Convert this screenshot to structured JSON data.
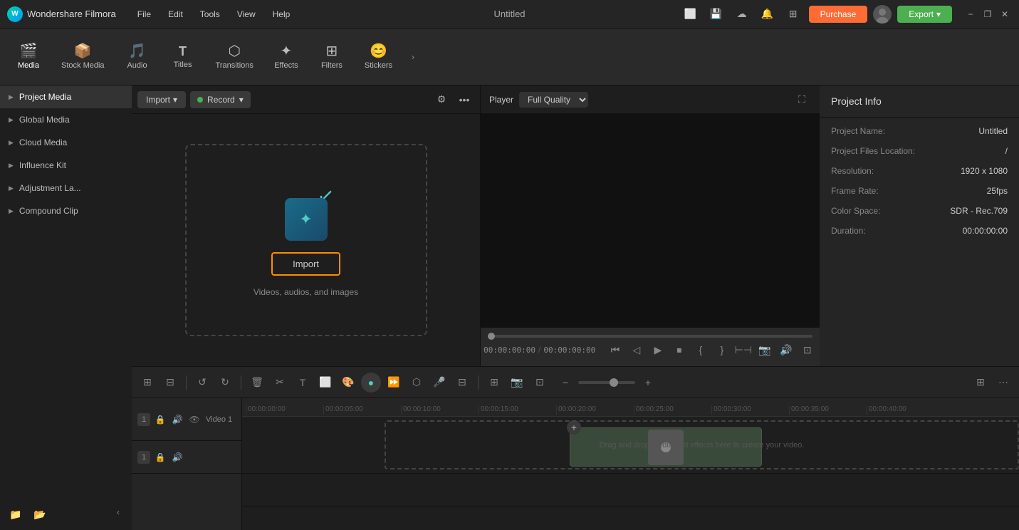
{
  "app": {
    "name": "Wondershare Filmora",
    "title": "Untitled"
  },
  "titlebar": {
    "menus": [
      "File",
      "Edit",
      "Tools",
      "View",
      "Help"
    ],
    "purchase_label": "Purchase",
    "export_label": "Export",
    "win_minimize": "−",
    "win_restore": "❐",
    "win_close": "✕"
  },
  "toolbar": {
    "items": [
      {
        "id": "media",
        "icon": "🎬",
        "label": "Media"
      },
      {
        "id": "stock",
        "icon": "📦",
        "label": "Stock Media"
      },
      {
        "id": "audio",
        "icon": "🎵",
        "label": "Audio"
      },
      {
        "id": "titles",
        "icon": "T",
        "label": "Titles"
      },
      {
        "id": "transitions",
        "icon": "⬡",
        "label": "Transitions"
      },
      {
        "id": "effects",
        "icon": "✦",
        "label": "Effects"
      },
      {
        "id": "filters",
        "icon": "⊞",
        "label": "Filters"
      },
      {
        "id": "stickers",
        "icon": "😊",
        "label": "Stickers"
      }
    ],
    "more_label": "›"
  },
  "sidebar": {
    "items": [
      {
        "id": "project-media",
        "label": "Project Media",
        "active": true
      },
      {
        "id": "global-media",
        "label": "Global Media"
      },
      {
        "id": "cloud-media",
        "label": "Cloud Media"
      },
      {
        "id": "influence-kit",
        "label": "Influence Kit"
      },
      {
        "id": "adjustment-layer",
        "label": "Adjustment La..."
      },
      {
        "id": "compound-clip",
        "label": "Compound Clip"
      }
    ]
  },
  "media_panel": {
    "import_label": "Import",
    "record_label": "Record",
    "drop_hint": "Videos, audios, and images",
    "import_center_label": "Import"
  },
  "preview": {
    "title": "Player",
    "quality": "Full Quality",
    "time_current": "00:00:00:00",
    "time_total": "00:00:00:00",
    "time_sep": "/"
  },
  "project_info": {
    "title": "Project Info",
    "fields": [
      {
        "label": "Project Name:",
        "value": "Untitled"
      },
      {
        "label": "Project Files Location:",
        "value": "/"
      },
      {
        "label": "Resolution:",
        "value": "1920 x 1080"
      },
      {
        "label": "Frame Rate:",
        "value": "25fps"
      },
      {
        "label": "Color Space:",
        "value": "SDR - Rec.709"
      },
      {
        "label": "Duration:",
        "value": "00:00:00:00"
      }
    ]
  },
  "timeline": {
    "ruler_marks": [
      "00:00:00:00",
      "00:00:05:00",
      "00:00:10:00",
      "00:00:15:00",
      "00:00:20:00",
      "00:00:25:00",
      "00:00:30:00",
      "00:00:35:00",
      "00:00:40:00"
    ],
    "tracks": [
      {
        "id": "video1",
        "label": "Video 1",
        "type": "video",
        "num": "1"
      },
      {
        "id": "audio1",
        "label": "",
        "type": "audio",
        "num": "1"
      }
    ],
    "drop_hint": "Drag and drop media and effects here to create your video."
  },
  "colors": {
    "accent": "#4ECDC4",
    "purchase": "#ff6b35",
    "export": "#4CAF50",
    "border_orange": "#ff8c00"
  }
}
